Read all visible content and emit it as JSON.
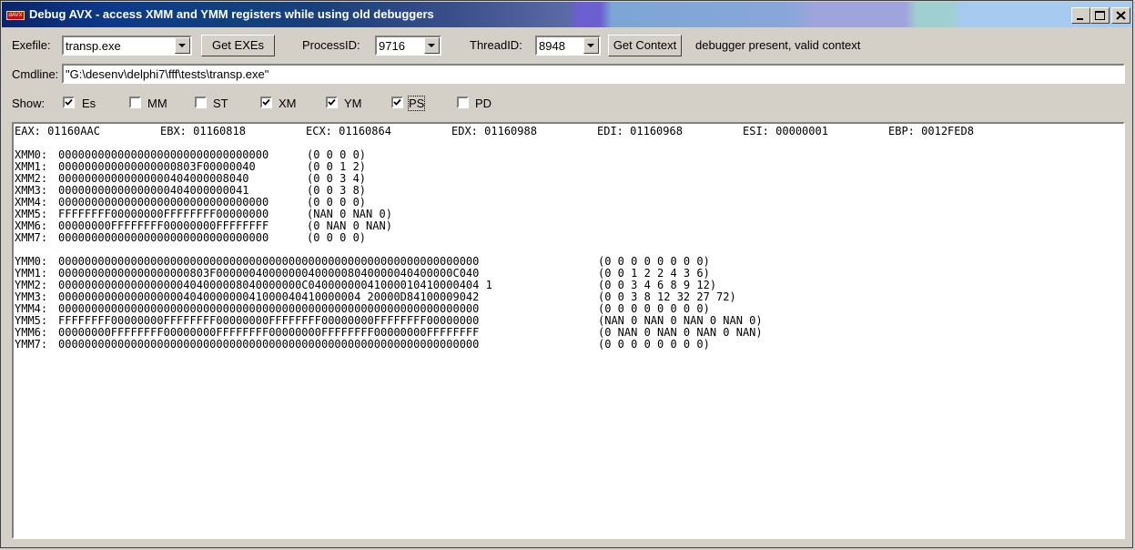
{
  "window": {
    "title": "Debug AVX - access XMM and YMM registers while using old debuggers",
    "icon_text": "dAVX"
  },
  "toolbar": {
    "exefile_label": "Exefile:",
    "exefile_value": "transp.exe",
    "get_exes_label": "Get EXEs",
    "processid_label": "ProcessID:",
    "processid_value": "9716",
    "threadid_label": "ThreadID:",
    "threadid_value": "8948",
    "get_context_label": "Get Context",
    "status_text": "debugger present, valid context"
  },
  "cmdline": {
    "label": "Cmdline:",
    "value": "\"G:\\desenv\\delphi7\\fff\\tests\\transp.exe\""
  },
  "show": {
    "label": "Show:",
    "options": [
      {
        "label": "Es",
        "checked": true
      },
      {
        "label": "MM",
        "checked": false
      },
      {
        "label": "ST",
        "checked": false
      },
      {
        "label": "XM",
        "checked": true
      },
      {
        "label": "YM",
        "checked": true
      },
      {
        "label": "PS",
        "checked": true
      },
      {
        "label": "PD",
        "checked": false
      }
    ]
  },
  "registers": {
    "general": [
      {
        "name": "EAX:",
        "value": "01160AAC"
      },
      {
        "name": "EBX:",
        "value": "01160818"
      },
      {
        "name": "ECX:",
        "value": "01160864"
      },
      {
        "name": "EDX:",
        "value": "01160988"
      },
      {
        "name": "EDI:",
        "value": "01160968"
      },
      {
        "name": "ESI:",
        "value": "00000001"
      },
      {
        "name": "EBP:",
        "value": "0012FED8"
      }
    ],
    "xmm": [
      {
        "name": "XMM0:",
        "hex": "00000000000000000000000000000000",
        "ps": "(0 0 0 0)"
      },
      {
        "name": "XMM1:",
        "hex": "000000000000000000803F00000040",
        "ps": "(0 0 1 2)"
      },
      {
        "name": "XMM2:",
        "hex": "00000000000000000404000008040",
        "ps": "(0 0 3 4)"
      },
      {
        "name": "XMM3:",
        "hex": "00000000000000000404000000041",
        "ps": "(0 0 3 8)"
      },
      {
        "name": "XMM4:",
        "hex": "00000000000000000000000000000000",
        "ps": "(0 0 0 0)"
      },
      {
        "name": "XMM5:",
        "hex": "FFFFFFFF00000000FFFFFFFF00000000",
        "ps": "(NAN 0 NAN 0)"
      },
      {
        "name": "XMM6:",
        "hex": "00000000FFFFFFFF00000000FFFFFFFF",
        "ps": "(0 NAN 0 NAN)"
      },
      {
        "name": "XMM7:",
        "hex": "00000000000000000000000000000000",
        "ps": "(0 0 0 0)"
      }
    ],
    "ymm": [
      {
        "name": "YMM0:",
        "hex": "0000000000000000000000000000000000000000000000000000000000000000",
        "ps": "(0 0 0 0 0 0 0 0)"
      },
      {
        "name": "YMM1:",
        "hex": "00000000000000000000803F000000400000004000008040000040400000C040",
        "ps": "(0 0 1 2 2 4 3 6)"
      },
      {
        "name": "YMM2:",
        "hex": "0000000000000000000404000008040000000C04000000041000010410000404 1",
        "ps": "(0 0 3 4 6 8 9 12)"
      },
      {
        "name": "YMM3:",
        "hex": "0000000000000000000404000000041000040410000004 20000D84100009042",
        "ps": "(0 0 3 8 12 32 27 72)"
      },
      {
        "name": "YMM4:",
        "hex": "0000000000000000000000000000000000000000000000000000000000000000",
        "ps": "(0 0 0 0 0 0 0 0)"
      },
      {
        "name": "YMM5:",
        "hex": "FFFFFFFF00000000FFFFFFFF00000000FFFFFFFF00000000FFFFFFFF00000000",
        "ps": "(NAN 0 NAN 0 NAN 0 NAN 0)"
      },
      {
        "name": "YMM6:",
        "hex": "00000000FFFFFFFF00000000FFFFFFFF00000000FFFFFFFF00000000FFFFFFFF",
        "ps": "(0 NAN 0 NAN 0 NAN 0 NAN)"
      },
      {
        "name": "YMM7:",
        "hex": "0000000000000000000000000000000000000000000000000000000000000000",
        "ps": "(0 0 0 0 0 0 0 0)"
      }
    ]
  }
}
